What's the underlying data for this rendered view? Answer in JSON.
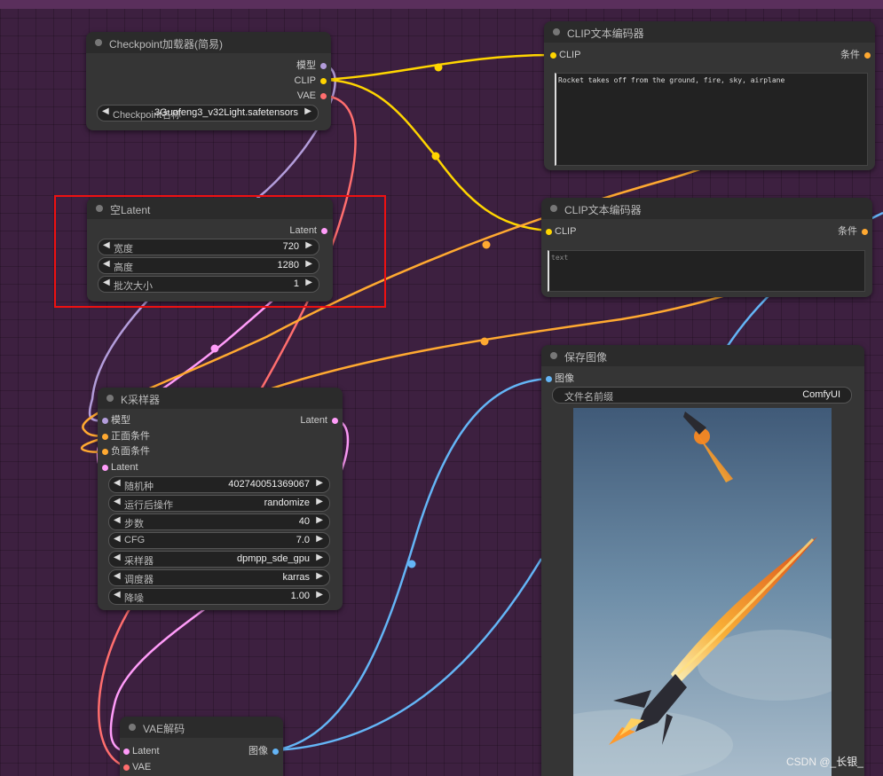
{
  "nodes": {
    "checkpoint": {
      "title": "Checkpoint加载器(简易)",
      "outputs": [
        "模型",
        "CLIP",
        "VAE"
      ],
      "ckpt_label": "Checkpoint名称",
      "ckpt_value": "3Guofeng3_v32Light.safetensors"
    },
    "empty_latent": {
      "title": "空Latent",
      "output": "Latent",
      "widgets": [
        {
          "label": "宽度",
          "value": "720"
        },
        {
          "label": "高度",
          "value": "1280"
        },
        {
          "label": "批次大小",
          "value": "1"
        }
      ]
    },
    "clip_pos": {
      "title": "CLIP文本编码器",
      "input": "CLIP",
      "output": "条件",
      "text": "Rocket takes off from the ground, fire, sky, airplane"
    },
    "clip_neg": {
      "title": "CLIP文本编码器",
      "input": "CLIP",
      "output": "条件",
      "placeholder": "text"
    },
    "ksampler": {
      "title": "K采样器",
      "inputs": [
        "模型",
        "正面条件",
        "负面条件",
        "Latent"
      ],
      "output": "Latent",
      "widgets": [
        {
          "label": "随机种",
          "value": "402740051369067"
        },
        {
          "label": "运行后操作",
          "value": "randomize"
        },
        {
          "label": "步数",
          "value": "40"
        },
        {
          "label": "CFG",
          "value": "7.0"
        },
        {
          "label": "采样器",
          "value": "dpmpp_sde_gpu"
        },
        {
          "label": "调度器",
          "value": "karras"
        },
        {
          "label": "降噪",
          "value": "1.00"
        }
      ]
    },
    "save_image": {
      "title": "保存图像",
      "input": "图像",
      "prefix_label": "文件名前缀",
      "prefix_value": "ComfyUI"
    },
    "vae_decode": {
      "title": "VAE解码",
      "inputs": [
        "Latent",
        "VAE"
      ],
      "output": "图像"
    }
  },
  "watermark": "CSDN @_长银_",
  "colors": {
    "model": "#b39ddb",
    "clip": "#ffd500",
    "vae": "#ff6e6e",
    "latent": "#ff9cf9",
    "conditioning": "#ffa931",
    "image": "#64b5f6",
    "highlight": "#ee1111"
  },
  "arrows": {
    "left": "◀",
    "right": "▶"
  }
}
